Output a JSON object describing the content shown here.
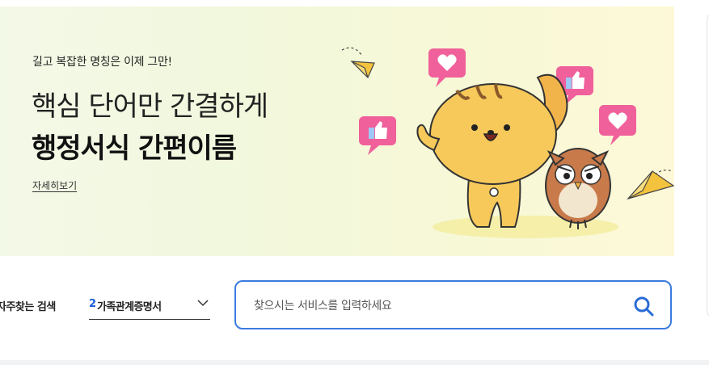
{
  "banner": {
    "subtitle": "길고 복잡한 명칭은 이제 그만!",
    "headline_line1": "핵심 단어만 간결하게",
    "headline_line2": "행정서식 간편이름",
    "more_link": "자세히보기"
  },
  "frequent_search": {
    "label": "자주찾는 검색",
    "selected_rank": "2",
    "selected_item": "가족관계증명서"
  },
  "search": {
    "placeholder": "찾으시는 서비스를 입력하세요"
  },
  "colors": {
    "accent_blue": "#3a7be0",
    "rank_blue": "#1a5ad8",
    "heart_pink": "#f0609b",
    "squirrel_yellow": "#f7c95a",
    "owl_brown": "#c87a4a"
  }
}
